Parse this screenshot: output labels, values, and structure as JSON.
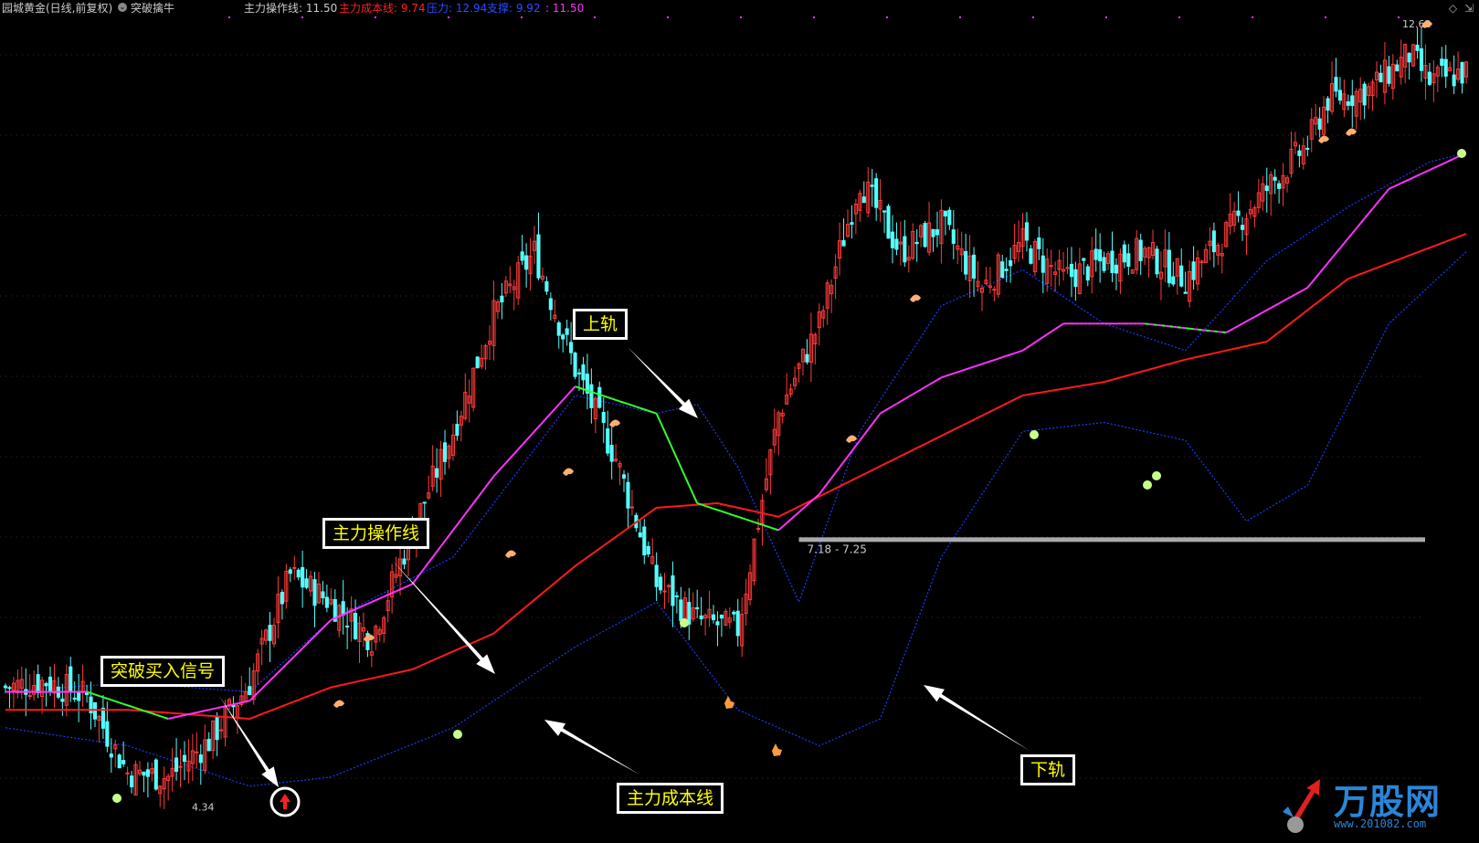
{
  "header": {
    "stock_title": "园城黄金(日线,前复权)",
    "indicator_name": "突破擒牛",
    "ops_line": "主力操作线: 11.50",
    "cost_line": "主力成本线: 9.74",
    "pressure": "压力: 12.94",
    "support": "支撑: 9.92",
    "extra": ": 11.50"
  },
  "labels": {
    "max_price": "12.62",
    "min_price": "4.34",
    "range_label": "7.18 - 7.25"
  },
  "callouts": {
    "upper_rail": "上轨",
    "ops_line": "主力操作线",
    "buy_signal": "突破买入信号",
    "cost_line": "主力成本线",
    "lower_rail": "下轨"
  },
  "watermark": {
    "brand": "万股网",
    "url": "www.201082.com"
  },
  "colors": {
    "up": "#ff3b3b",
    "down": "#55ffff",
    "ops_line": "#ff33ff",
    "ops_line_flat": "#33ff33",
    "cost_line": "#ff1a1a",
    "bands": "#1a3bff",
    "yellow": "#ffff00"
  },
  "chart_data": {
    "type": "candlestick",
    "title": "园城黄金(日线,前复权)",
    "ylim": [
      4.0,
      13.0
    ],
    "price_samples": [
      {
        "bar": 0,
        "c": 5.55
      },
      {
        "bar": 10,
        "c": 5.62
      },
      {
        "bar": 20,
        "c": 5.45
      },
      {
        "bar": 30,
        "c": 4.6
      },
      {
        "bar": 40,
        "c": 4.55
      },
      {
        "bar": 50,
        "c": 4.95
      },
      {
        "bar": 60,
        "c": 5.6
      },
      {
        "bar": 70,
        "c": 6.8
      },
      {
        "bar": 80,
        "c": 6.5
      },
      {
        "bar": 90,
        "c": 6.1
      },
      {
        "bar": 100,
        "c": 7.3
      },
      {
        "bar": 110,
        "c": 8.4
      },
      {
        "bar": 120,
        "c": 9.7
      },
      {
        "bar": 130,
        "c": 10.4
      },
      {
        "bar": 140,
        "c": 9.1
      },
      {
        "bar": 150,
        "c": 8.1
      },
      {
        "bar": 160,
        "c": 6.7
      },
      {
        "bar": 170,
        "c": 6.3
      },
      {
        "bar": 180,
        "c": 6.2
      },
      {
        "bar": 190,
        "c": 8.6
      },
      {
        "bar": 200,
        "c": 9.6
      },
      {
        "bar": 210,
        "c": 11.2
      },
      {
        "bar": 220,
        "c": 10.4
      },
      {
        "bar": 230,
        "c": 10.7
      },
      {
        "bar": 240,
        "c": 10.0
      },
      {
        "bar": 250,
        "c": 10.5
      },
      {
        "bar": 260,
        "c": 10.1
      },
      {
        "bar": 270,
        "c": 10.3
      },
      {
        "bar": 280,
        "c": 10.4
      },
      {
        "bar": 290,
        "c": 10.1
      },
      {
        "bar": 300,
        "c": 10.6
      },
      {
        "bar": 310,
        "c": 11.1
      },
      {
        "bar": 320,
        "c": 11.6
      },
      {
        "bar": 325,
        "c": 12.1
      },
      {
        "bar": 335,
        "c": 12.2
      },
      {
        "bar": 345,
        "c": 12.6
      },
      {
        "bar": 350,
        "c": 12.3
      },
      {
        "bar": 359,
        "c": 12.4
      }
    ],
    "ops_line_samples": [
      {
        "bar": 0,
        "v": 5.5
      },
      {
        "bar": 20,
        "v": 5.5
      },
      {
        "bar": 40,
        "v": 5.2
      },
      {
        "bar": 60,
        "v": 5.4
      },
      {
        "bar": 80,
        "v": 6.3
      },
      {
        "bar": 100,
        "v": 6.7
      },
      {
        "bar": 120,
        "v": 7.9
      },
      {
        "bar": 140,
        "v": 8.9
      },
      {
        "bar": 160,
        "v": 8.6
      },
      {
        "bar": 170,
        "v": 7.6
      },
      {
        "bar": 190,
        "v": 7.3
      },
      {
        "bar": 200,
        "v": 7.7
      },
      {
        "bar": 215,
        "v": 8.6
      },
      {
        "bar": 230,
        "v": 9.0
      },
      {
        "bar": 250,
        "v": 9.3
      },
      {
        "bar": 260,
        "v": 9.6
      },
      {
        "bar": 280,
        "v": 9.6
      },
      {
        "bar": 300,
        "v": 9.5
      },
      {
        "bar": 320,
        "v": 10.0
      },
      {
        "bar": 340,
        "v": 11.1
      },
      {
        "bar": 359,
        "v": 11.5
      }
    ],
    "cost_line_samples": [
      {
        "bar": 0,
        "v": 5.3
      },
      {
        "bar": 30,
        "v": 5.3
      },
      {
        "bar": 60,
        "v": 5.2
      },
      {
        "bar": 80,
        "v": 5.55
      },
      {
        "bar": 100,
        "v": 5.75
      },
      {
        "bar": 120,
        "v": 6.15
      },
      {
        "bar": 140,
        "v": 6.9
      },
      {
        "bar": 160,
        "v": 7.55
      },
      {
        "bar": 175,
        "v": 7.6
      },
      {
        "bar": 190,
        "v": 7.45
      },
      {
        "bar": 210,
        "v": 7.9
      },
      {
        "bar": 230,
        "v": 8.35
      },
      {
        "bar": 250,
        "v": 8.8
      },
      {
        "bar": 270,
        "v": 8.95
      },
      {
        "bar": 290,
        "v": 9.2
      },
      {
        "bar": 310,
        "v": 9.4
      },
      {
        "bar": 330,
        "v": 10.1
      },
      {
        "bar": 359,
        "v": 10.6
      }
    ],
    "upper_band_samples": [
      {
        "bar": 0,
        "v": 5.5
      },
      {
        "bar": 30,
        "v": 5.6
      },
      {
        "bar": 60,
        "v": 5.5
      },
      {
        "bar": 80,
        "v": 6.3
      },
      {
        "bar": 110,
        "v": 7.0
      },
      {
        "bar": 140,
        "v": 8.8
      },
      {
        "bar": 160,
        "v": 8.6
      },
      {
        "bar": 170,
        "v": 8.7
      },
      {
        "bar": 180,
        "v": 8.0
      },
      {
        "bar": 195,
        "v": 6.5
      },
      {
        "bar": 210,
        "v": 8.4
      },
      {
        "bar": 230,
        "v": 9.8
      },
      {
        "bar": 250,
        "v": 10.2
      },
      {
        "bar": 270,
        "v": 9.6
      },
      {
        "bar": 290,
        "v": 9.3
      },
      {
        "bar": 310,
        "v": 10.3
      },
      {
        "bar": 330,
        "v": 10.9
      },
      {
        "bar": 350,
        "v": 11.4
      },
      {
        "bar": 359,
        "v": 11.5
      }
    ],
    "lower_band_samples": [
      {
        "bar": 0,
        "v": 5.1
      },
      {
        "bar": 30,
        "v": 4.9
      },
      {
        "bar": 60,
        "v": 4.45
      },
      {
        "bar": 80,
        "v": 4.55
      },
      {
        "bar": 110,
        "v": 5.1
      },
      {
        "bar": 140,
        "v": 6.0
      },
      {
        "bar": 160,
        "v": 6.5
      },
      {
        "bar": 180,
        "v": 5.3
      },
      {
        "bar": 200,
        "v": 4.9
      },
      {
        "bar": 215,
        "v": 5.2
      },
      {
        "bar": 230,
        "v": 7.0
      },
      {
        "bar": 250,
        "v": 8.4
      },
      {
        "bar": 270,
        "v": 8.5
      },
      {
        "bar": 290,
        "v": 8.3
      },
      {
        "bar": 305,
        "v": 7.4
      },
      {
        "bar": 320,
        "v": 7.8
      },
      {
        "bar": 340,
        "v": 9.6
      },
      {
        "bar": 359,
        "v": 10.4
      }
    ],
    "support_range_price": 7.2
  }
}
